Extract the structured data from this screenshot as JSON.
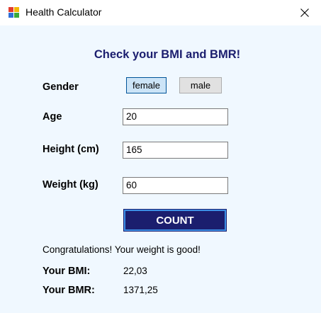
{
  "window": {
    "title": "Health Calculator",
    "icons": {
      "app": "app-icon",
      "close": "close-icon"
    }
  },
  "heading": "Check your BMI and BMR!",
  "form": {
    "gender_label": "Gender",
    "gender_options": [
      "female",
      "male"
    ],
    "gender_selected": "female",
    "age_label": "Age",
    "age_value": "20",
    "height_label": "Height (cm)",
    "height_value": "165",
    "weight_label": "Weight (kg)",
    "weight_value": "60",
    "count_label": "COUNT"
  },
  "results": {
    "message": "Congratulations! Your weight is good!",
    "bmi_label": "Your BMI:",
    "bmi_value": "22,03",
    "bmr_label": "Your BMR:",
    "bmr_value": "1371,25"
  },
  "colors": {
    "background": "#F0F8FF",
    "heading": "#1B1E6E",
    "count_button": "#1B1E6E",
    "count_border": "#3C8FE6",
    "selected_gender": "#CCE4F7"
  }
}
